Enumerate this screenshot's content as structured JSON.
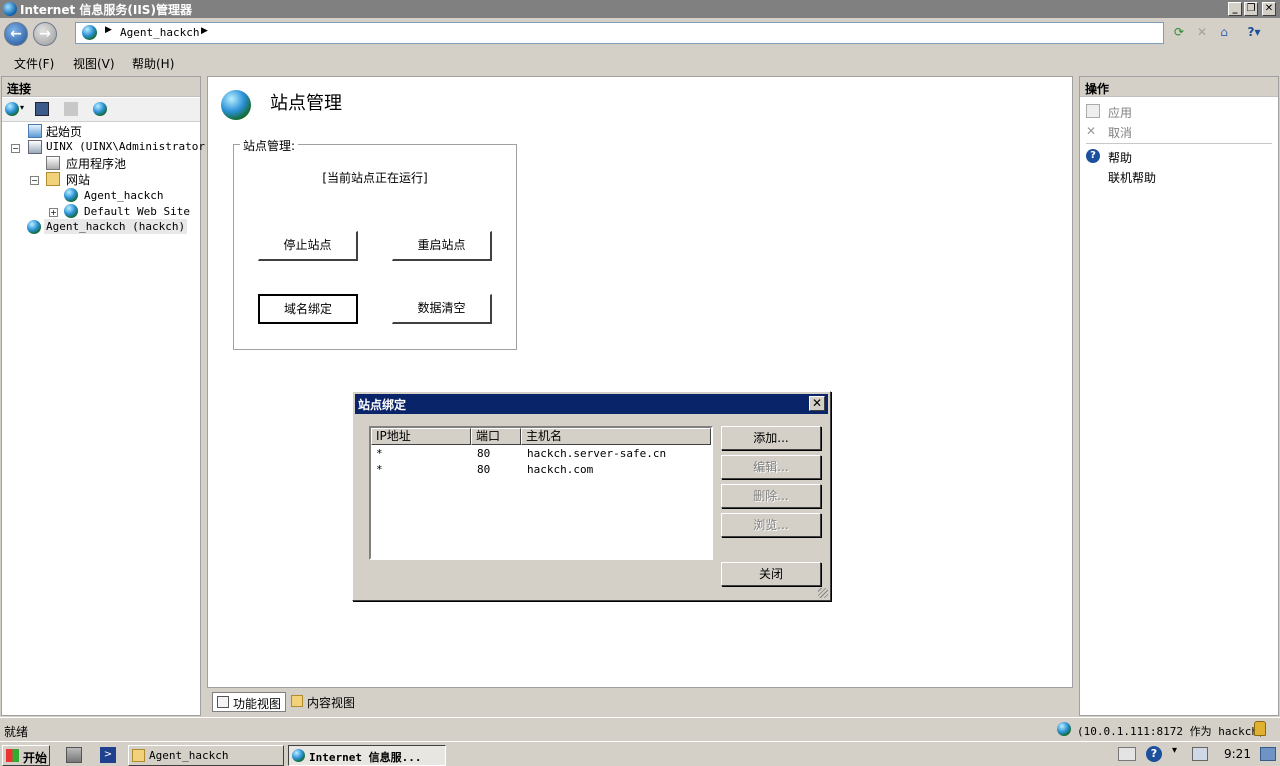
{
  "window": {
    "title": "Internet 信息服务(IIS)管理器"
  },
  "address": {
    "path": "Agent_hackch"
  },
  "menu": [
    "文件(F)",
    "视图(V)",
    "帮助(H)"
  ],
  "connections": {
    "header": "连接",
    "tree": {
      "start": "起始页",
      "server": "UINX (UINX\\Administrator)",
      "app_pools": "应用程序池",
      "sites": "网站",
      "site1": "Agent_hackch",
      "site2": "Default Web Site",
      "connection": "Agent_hackch (hackch)"
    }
  },
  "main": {
    "title": "站点管理",
    "group_label": "站点管理:",
    "status": "[当前站点正在运行]",
    "buttons": {
      "stop": "停止站点",
      "restart": "重启站点",
      "bind": "域名绑定",
      "clear": "数据清空"
    }
  },
  "view_tabs": {
    "features": "功能视图",
    "content": "内容视图"
  },
  "actions": {
    "header": "操作",
    "apply": "应用",
    "cancel": "取消",
    "help": "帮助",
    "online_help": "联机帮助"
  },
  "dialog": {
    "title": "站点绑定",
    "columns": {
      "ip": "IP地址",
      "port": "端口",
      "host": "主机名"
    },
    "rows": [
      {
        "ip": "*",
        "port": "80",
        "host": "hackch.server-safe.cn"
      },
      {
        "ip": "*",
        "port": "80",
        "host": "hackch.com"
      }
    ],
    "buttons": {
      "add": "添加...",
      "edit": "编辑...",
      "remove": "删除...",
      "browse": "浏览...",
      "close": "关闭"
    }
  },
  "statusbar": {
    "left": "就绪",
    "right": "(10.0.1.111:8172 作为 hackch)"
  },
  "taskbar": {
    "start": "开始",
    "tasks": [
      "Agent_hackch",
      "Internet 信息服..."
    ],
    "clock": "9:21"
  }
}
